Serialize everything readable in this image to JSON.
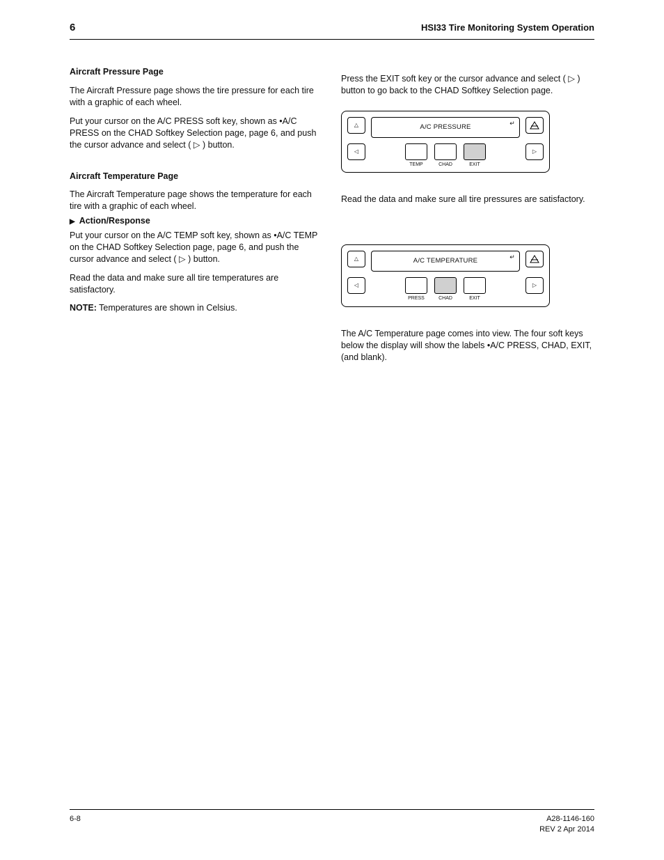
{
  "header": {
    "slot": "6",
    "section_title": "HSI33 Tire Monitoring System Operation"
  },
  "left": {
    "heading": "Aircraft Pressure Page",
    "p1": "The Aircraft Pressure page shows the tire pressure for each tire with a graphic of each wheel.",
    "p2_a": "Put your cursor on the A/C PRESS soft key, shown as •A/C PRESS on the ",
    "p2_b": "CHAD Softkey Selection page, page 6, and push the cursor advance and select (",
    "p2_c": " ) button.",
    "heading2": "Aircraft Temperature Page",
    "p3": "The Aircraft Temperature page shows the temperature for each tire with a graphic of each wheel.",
    "step": "Action/Response",
    "step_p1_a": "Put your cursor on the A/C TEMP soft key, shown as •A/C TEMP on the ",
    "step_p1_b": "CHAD Softkey Selection page, page 6, and push the cursor advance and select (",
    "step_p1_c": " ) button.",
    "note": "Read the data and make sure all tire temperatures are satisfactory.",
    "note_label": "NOTE:",
    "note_body": "Temperatures are shown in Celsius."
  },
  "right": {
    "intro": "Press the EXIT soft key or the cursor advance and select ( ",
    "intro2": " ) button to go back to the CHAD Softkey Selection page.",
    "chad1": {
      "display_text": "A/C   PRESSURE",
      "softlabels": [
        "TEMP",
        "CHAD",
        "EXIT"
      ],
      "highlight_index": 2
    },
    "mid": "Read the data and make sure all tire pressures are satisfactory.",
    "chad2": {
      "display_text": "A/C   TEMPERATURE",
      "softlabels": [
        "PRESS",
        "CHAD",
        "EXIT"
      ],
      "highlight_index": 1
    },
    "after": "The A/C Temperature page comes into view. The four soft keys below the display will show the labels •A/C PRESS,   CHAD,   EXIT,   (and blank)."
  },
  "footer": {
    "left": "6-8",
    "right": "A28-1146-160\nREV 2   Apr 2014"
  }
}
